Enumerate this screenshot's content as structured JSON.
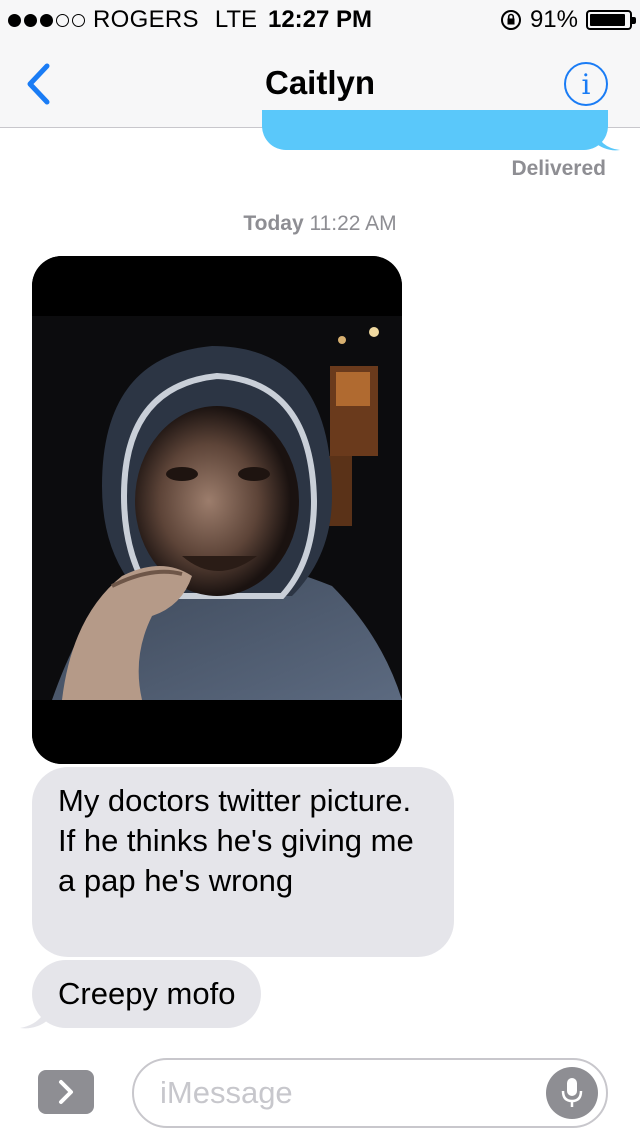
{
  "status_bar": {
    "carrier": "ROGERS",
    "network": "LTE",
    "time": "12:27 PM",
    "battery_percent": "91%",
    "battery_level": 0.91,
    "signal_strength": 3,
    "signal_max": 5
  },
  "nav": {
    "title": "Caitlyn",
    "info_glyph": "i"
  },
  "thread": {
    "sent_status": "Delivered",
    "timestamp_day": "Today",
    "timestamp_time": "11:22 AM",
    "received_messages": [
      "My doctors twitter picture. If he thinks he's giving me a pap he's wrong",
      "Creepy mofo"
    ]
  },
  "input_bar": {
    "placeholder": "iMessage"
  },
  "colors": {
    "ios_blue": "#1a7cf5",
    "sent_bubble": "#5ac8fa",
    "received_bubble": "#e5e5ea",
    "gray_text": "#8e8e93"
  },
  "icons": {
    "back": "chevron-left-icon",
    "info": "info-icon",
    "apps": "chevron-right-icon",
    "mic": "microphone-icon",
    "lock": "rotation-lock-icon",
    "battery": "battery-icon",
    "signal": "signal-dots-icon"
  }
}
